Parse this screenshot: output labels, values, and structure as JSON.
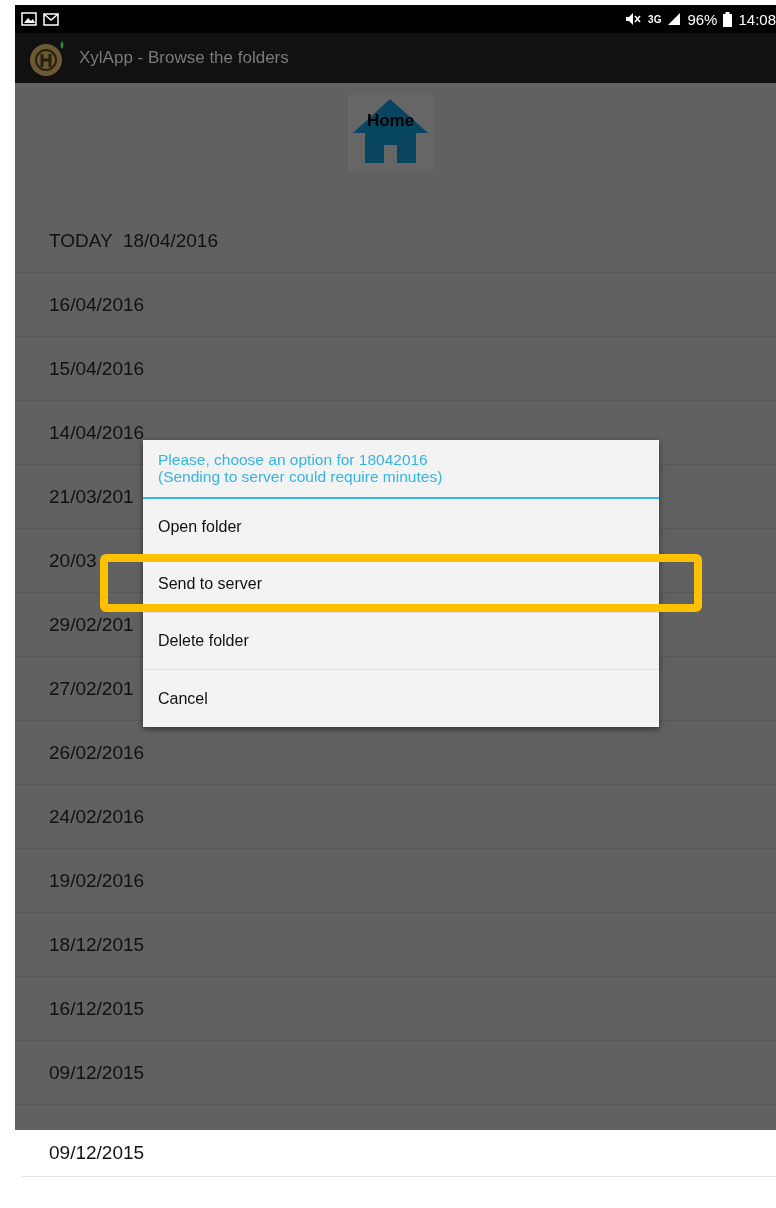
{
  "status_bar": {
    "network": "3G",
    "battery": "96%",
    "time": "14:08"
  },
  "app_bar": {
    "title": "XylApp - Browse the folders"
  },
  "home_button": {
    "label": "Home"
  },
  "folders": [
    {
      "label": "TODAY  18/04/2016"
    },
    {
      "label": "16/04/2016"
    },
    {
      "label": "15/04/2016"
    },
    {
      "label": "14/04/2016"
    },
    {
      "label": "21/03/201"
    },
    {
      "label": "20/03"
    },
    {
      "label": "29/02/201"
    },
    {
      "label": "27/02/201"
    },
    {
      "label": "26/02/2016"
    },
    {
      "label": "24/02/2016"
    },
    {
      "label": "19/02/2016"
    },
    {
      "label": "18/12/2015"
    },
    {
      "label": "16/12/2015"
    },
    {
      "label": "09/12/2015"
    }
  ],
  "dialog": {
    "title": "Please, choose an option for 18042016\n(Sending to server could require minutes)",
    "options": [
      {
        "label": "Open folder",
        "highlighted": false
      },
      {
        "label": "Send to server",
        "highlighted": true
      },
      {
        "label": "Delete folder",
        "highlighted": false
      },
      {
        "label": "Cancel",
        "highlighted": false
      }
    ]
  },
  "lower_list": [
    {
      "label": "09/12/2015"
    }
  ]
}
